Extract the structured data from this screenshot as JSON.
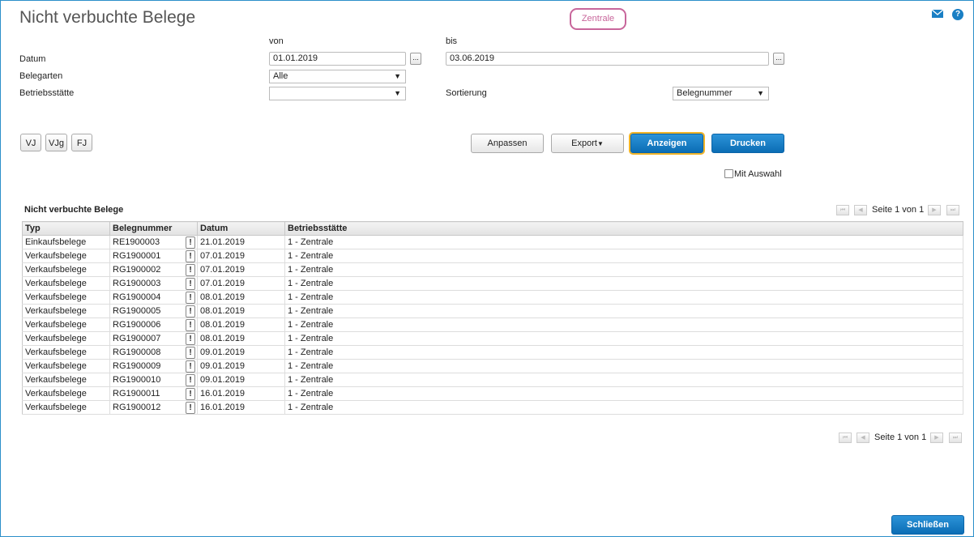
{
  "header": {
    "title": "Nicht verbuchte Belege",
    "branch": "Zentrale"
  },
  "icons": {
    "mail": "mail-icon",
    "help": "help-icon"
  },
  "filters": {
    "von_label": "von",
    "bis_label": "bis",
    "datum_label": "Datum",
    "datum_von": "01.01.2019",
    "datum_bis": "03.06.2019",
    "picker_label": "...",
    "belegarten_label": "Belegarten",
    "belegarten_value": "Alle",
    "betriebsstaette_label": "Betriebsstätte",
    "betriebsstaette_value": "",
    "sortierung_label": "Sortierung",
    "sortierung_value": "Belegnummer"
  },
  "period_buttons": [
    "VJ",
    "VJg",
    "FJ"
  ],
  "actions": {
    "anpassen": "Anpassen",
    "export": "Export",
    "anzeigen": "Anzeigen",
    "drucken": "Drucken",
    "mit_auswahl": "Mit Auswahl"
  },
  "table": {
    "title": "Nicht verbuchte Belege",
    "pager_text": "Seite 1 von 1",
    "columns": [
      "Typ",
      "Belegnummer",
      "Datum",
      "Betriebsstätte"
    ],
    "rows": [
      [
        "Einkaufsbelege",
        "RE1900003",
        "21.01.2019",
        "1 - Zentrale"
      ],
      [
        "Verkaufsbelege",
        "RG1900001",
        "07.01.2019",
        "1 - Zentrale"
      ],
      [
        "Verkaufsbelege",
        "RG1900002",
        "07.01.2019",
        "1 - Zentrale"
      ],
      [
        "Verkaufsbelege",
        "RG1900003",
        "07.01.2019",
        "1 - Zentrale"
      ],
      [
        "Verkaufsbelege",
        "RG1900004",
        "08.01.2019",
        "1 - Zentrale"
      ],
      [
        "Verkaufsbelege",
        "RG1900005",
        "08.01.2019",
        "1 - Zentrale"
      ],
      [
        "Verkaufsbelege",
        "RG1900006",
        "08.01.2019",
        "1 - Zentrale"
      ],
      [
        "Verkaufsbelege",
        "RG1900007",
        "08.01.2019",
        "1 - Zentrale"
      ],
      [
        "Verkaufsbelege",
        "RG1900008",
        "09.01.2019",
        "1 - Zentrale"
      ],
      [
        "Verkaufsbelege",
        "RG1900009",
        "09.01.2019",
        "1 - Zentrale"
      ],
      [
        "Verkaufsbelege",
        "RG1900010",
        "09.01.2019",
        "1 - Zentrale"
      ],
      [
        "Verkaufsbelege",
        "RG1900011",
        "16.01.2019",
        "1 - Zentrale"
      ],
      [
        "Verkaufsbelege",
        "RG1900012",
        "16.01.2019",
        "1 - Zentrale"
      ]
    ],
    "row_flag": "!"
  },
  "footer": {
    "close": "Schließen"
  },
  "colors": {
    "accent": "#1a7fc4",
    "branch_border": "#c8669b",
    "focus": "#f0b429"
  }
}
